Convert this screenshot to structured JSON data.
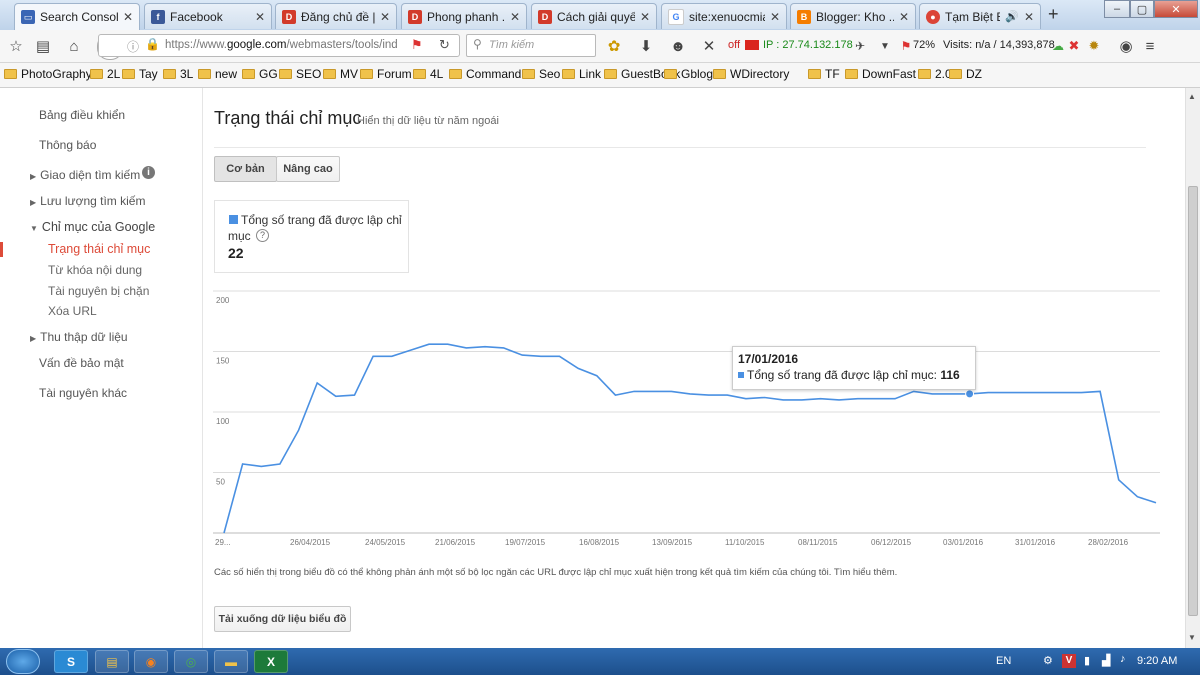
{
  "tabs": [
    {
      "title": "Search Consol...",
      "icon": "search-console-icon",
      "color": "#3a66b5",
      "active": true
    },
    {
      "title": "Facebook",
      "icon": "facebook-icon",
      "color": "#3b5998"
    },
    {
      "title": "Đăng chủ đề | ...",
      "icon": "forum-icon",
      "color": "#d23a2a"
    },
    {
      "title": "Phong phanh ...",
      "icon": "forum-icon",
      "color": "#d23a2a"
    },
    {
      "title": "Cách giải quyế...",
      "icon": "forum-icon",
      "color": "#d23a2a"
    },
    {
      "title": "site:xenuocmia...",
      "icon": "google-icon",
      "color": "#4285f4"
    },
    {
      "title": "Blogger: Kho ...",
      "icon": "blogger-icon",
      "color": "#f57d00"
    },
    {
      "title": "Tạm Biệt B...",
      "icon": "chrome-icon",
      "color": "#db4437"
    }
  ],
  "toolbar": {
    "url_prefix": "https://www.",
    "url_domain": "google.com",
    "url_path": "/webmasters/tools/ind",
    "search_placeholder": "Tìm kiếm",
    "off_label": "off",
    "ip_text": "IP : 27.74.132.178",
    "percent": "72%",
    "visits": "Visits: n/a / 14,393,878"
  },
  "bookmarks": [
    "PhotoGraphy",
    "2L",
    "Tay",
    "3L",
    "new",
    "GG",
    "SEO",
    "MV",
    "Forum",
    "4L",
    "Command",
    "Seo",
    "Link",
    "GuestBook",
    "Gblog",
    "WDirectory",
    "TF",
    "DownFast",
    "2.0",
    "DZ"
  ],
  "sidebar": {
    "dashboard": "Bảng điều khiển",
    "messages": "Thông báo",
    "search_appearance": "Giao diện tìm kiếm",
    "search_traffic": "Lưu lượng tìm kiếm",
    "google_index": "Chỉ mục của Google",
    "index_status": "Trạng thái chỉ mục",
    "content_keywords": "Từ khóa nội dung",
    "blocked_resources": "Tài nguyên bị chặn",
    "remove_urls": "Xóa URL",
    "crawl": "Thu thập dữ liệu",
    "security_issues": "Vấn đề bảo mật",
    "other_resources": "Tài nguyên khác"
  },
  "main": {
    "title": "Trạng thái chỉ mục",
    "subtitle": "Hiển thị dữ liệu từ năm ngoái",
    "tab_basic": "Cơ bản",
    "tab_advanced": "Nâng cao",
    "stat_label_1": "Tổng số trang đã được lập chỉ",
    "stat_label_2": "mục",
    "stat_value": "22",
    "footnote": "Các số hiển thị trong biểu đồ có thể không phản ánh một số bộ lọc ngăn các URL được lập chỉ mục xuất hiện trong kết quả tìm kiếm của chúng tôi. Tìm hiểu thêm.",
    "download_button": "Tải xuống dữ liệu biểu đồ"
  },
  "tooltip": {
    "date": "17/01/2016",
    "label": "Tổng số trang đã được lập chỉ mục: ",
    "value": "116"
  },
  "taskbar": {
    "lang": "EN",
    "time": "9:20 AM"
  },
  "colors": {
    "accent": "#dd4b39",
    "series": "#4a90e2"
  },
  "chart_data": {
    "type": "line",
    "ylim": [
      0,
      200
    ],
    "yticks": [
      50,
      100,
      150,
      200
    ],
    "xticks": [
      "29...",
      "26/04/2015",
      "24/05/2015",
      "21/06/2015",
      "19/07/2015",
      "16/08/2015",
      "13/09/2015",
      "11/10/2015",
      "08/11/2015",
      "06/12/2015",
      "03/01/2016",
      "31/01/2016",
      "28/02/2016"
    ],
    "series": [
      {
        "name": "Tổng số trang đã được lập chỉ mục",
        "values": [
          0,
          57,
          55,
          57,
          85,
          124,
          113,
          114,
          146,
          146,
          151,
          156,
          156,
          153,
          154,
          153,
          147,
          146,
          146,
          136,
          130,
          114,
          117,
          117,
          117,
          115,
          114,
          114,
          111,
          112,
          110,
          110,
          111,
          110,
          111,
          111,
          111,
          117,
          115,
          115,
          115,
          116,
          116,
          116,
          116,
          116,
          116,
          117,
          44,
          30,
          25
        ]
      }
    ]
  }
}
